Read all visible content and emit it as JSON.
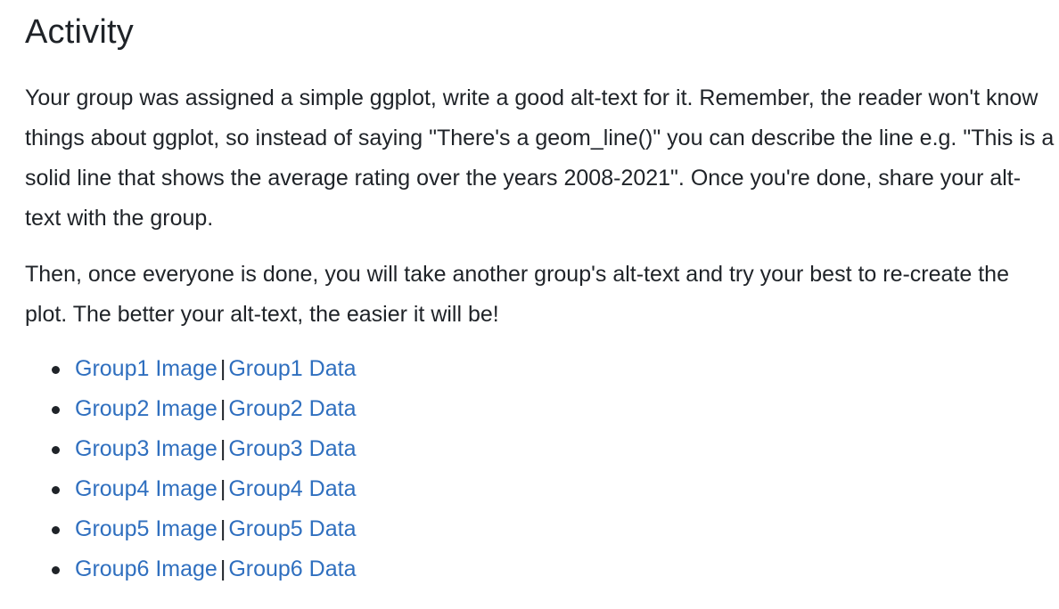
{
  "section": {
    "title": "Activity"
  },
  "paragraphs": {
    "p1": "Your group was assigned a simple ggplot, write a good alt-text for it. Remember, the reader won't know things about ggplot, so instead of saying \"There's a geom_line()\" you can describe the line e.g. \"This is a solid line that shows the average rating over the years 2008-2021\". Once you're done, share your alt-text with the group.",
    "p2": "Then, once everyone is done, you will take another group's alt-text and try your best to re-create the plot. The better your alt-text, the easier it will be!"
  },
  "groups": [
    {
      "image_label": "Group1 Image",
      "separator": "|",
      "data_label": "Group1 Data"
    },
    {
      "image_label": "Group2 Image",
      "separator": "|",
      "data_label": "Group2 Data"
    },
    {
      "image_label": "Group3 Image",
      "separator": "|",
      "data_label": "Group3 Data"
    },
    {
      "image_label": "Group4 Image",
      "separator": "|",
      "data_label": "Group4 Data"
    },
    {
      "image_label": "Group5 Image",
      "separator": "|",
      "data_label": "Group5 Data"
    },
    {
      "image_label": "Group6 Image",
      "separator": "|",
      "data_label": "Group6 Data"
    }
  ],
  "colors": {
    "text": "#1f2328",
    "link": "#2f6fbf",
    "background": "#ffffff"
  }
}
